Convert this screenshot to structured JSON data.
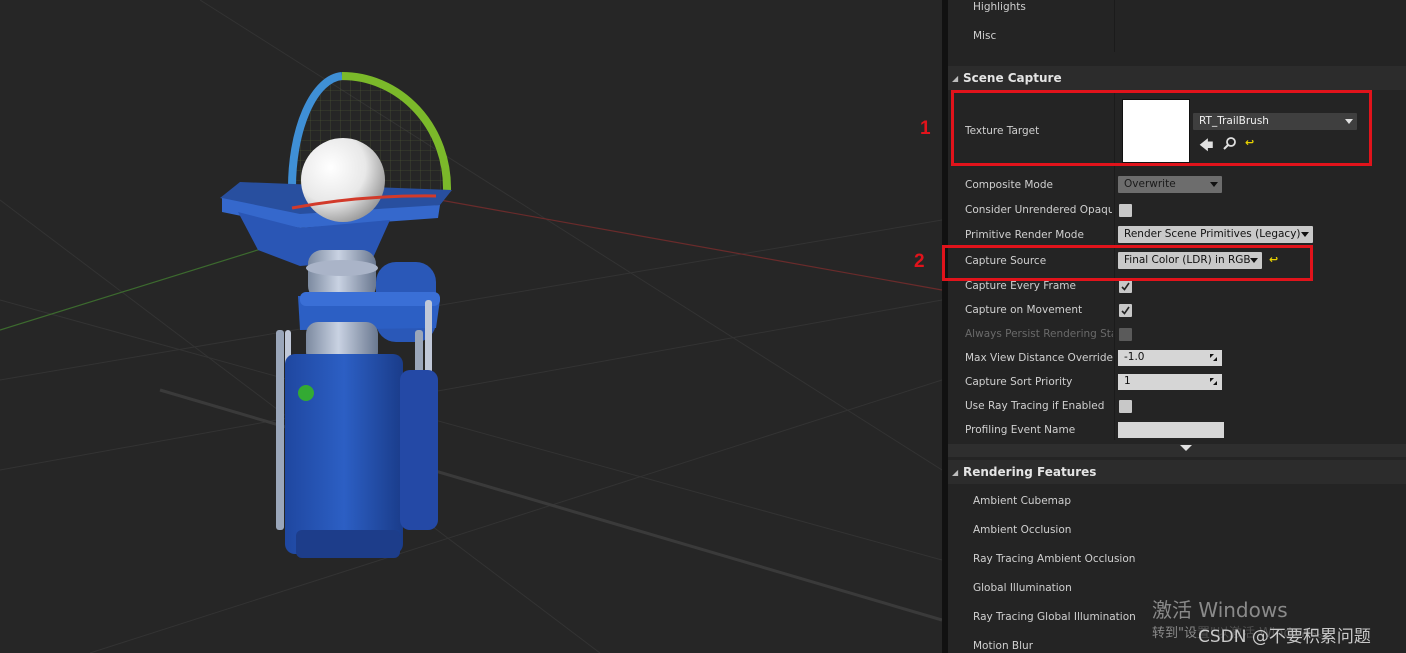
{
  "panel": {
    "top_items": [
      "Highlights",
      "Misc"
    ],
    "scene_capture": {
      "title": "Scene Capture",
      "texture_target": {
        "label": "Texture Target",
        "asset": "RT_TrailBrush"
      },
      "rows": {
        "composite_mode": {
          "label": "Composite Mode",
          "value": "Overwrite"
        },
        "consider_unrendered": {
          "label": "Consider Unrendered Opaque",
          "checked": false
        },
        "primitive_render_mode": {
          "label": "Primitive Render Mode",
          "value": "Render Scene Primitives (Legacy)"
        },
        "capture_source": {
          "label": "Capture Source",
          "value": "Final Color (LDR) in RGB"
        },
        "capture_every_frame": {
          "label": "Capture Every Frame",
          "checked": true
        },
        "capture_on_movement": {
          "label": "Capture on Movement",
          "checked": true
        },
        "always_persist": {
          "label": "Always Persist Rendering Sta",
          "checked": false,
          "disabled": true
        },
        "max_view_distance": {
          "label": "Max View Distance Override",
          "value": "-1.0"
        },
        "capture_sort_priority": {
          "label": "Capture Sort Priority",
          "value": "1"
        },
        "use_ray_tracing": {
          "label": "Use Ray Tracing if Enabled",
          "checked": false
        },
        "profiling_event_name": {
          "label": "Profiling Event Name",
          "value": ""
        }
      }
    },
    "rendering_features": {
      "title": "Rendering Features",
      "items": [
        "Ambient Cubemap",
        "Ambient Occlusion",
        "Ray Tracing Ambient Occlusion",
        "Global Illumination",
        "Ray Tracing Global Illumination",
        "Motion Blur"
      ]
    }
  },
  "annotations": {
    "box1": "1",
    "box2": "2"
  },
  "watermark": {
    "activate_title": "激活 Windows",
    "activate_sub": "转到\"设置\"以激活 Windows。",
    "csdn": "CSDN @不要积累问题"
  },
  "colors": {
    "annotation_red": "#e1131b",
    "object_blue": "#2c5fc4",
    "gizmo_green": "#7bb92a",
    "gizmo_blue": "#3f8fd6",
    "status_light": "#33aa33"
  }
}
